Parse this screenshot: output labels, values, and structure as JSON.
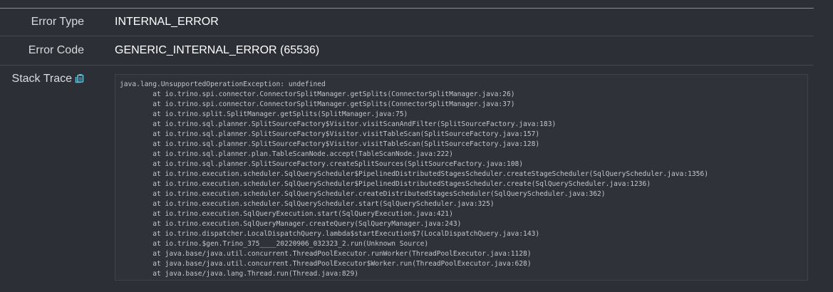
{
  "details": {
    "error_type": {
      "label": "Error Type",
      "value": "INTERNAL_ERROR"
    },
    "error_code": {
      "label": "Error Code",
      "value": "GENERIC_INTERNAL_ERROR (65536)"
    },
    "stack_trace": {
      "label": "Stack Trace",
      "copy_icon": "clipboard-icon",
      "accent_color": "#5bc0de",
      "text": "java.lang.UnsupportedOperationException: undefined\n\tat io.trino.spi.connector.ConnectorSplitManager.getSplits(ConnectorSplitManager.java:26)\n\tat io.trino.spi.connector.ConnectorSplitManager.getSplits(ConnectorSplitManager.java:37)\n\tat io.trino.split.SplitManager.getSplits(SplitManager.java:75)\n\tat io.trino.sql.planner.SplitSourceFactory$Visitor.visitScanAndFilter(SplitSourceFactory.java:183)\n\tat io.trino.sql.planner.SplitSourceFactory$Visitor.visitTableScan(SplitSourceFactory.java:157)\n\tat io.trino.sql.planner.SplitSourceFactory$Visitor.visitTableScan(SplitSourceFactory.java:128)\n\tat io.trino.sql.planner.plan.TableScanNode.accept(TableScanNode.java:222)\n\tat io.trino.sql.planner.SplitSourceFactory.createSplitSources(SplitSourceFactory.java:108)\n\tat io.trino.execution.scheduler.SqlQueryScheduler$PipelinedDistributedStagesScheduler.createStageScheduler(SqlQueryScheduler.java:1356)\n\tat io.trino.execution.scheduler.SqlQueryScheduler$PipelinedDistributedStagesScheduler.create(SqlQueryScheduler.java:1236)\n\tat io.trino.execution.scheduler.SqlQueryScheduler.createDistributedStagesScheduler(SqlQueryScheduler.java:362)\n\tat io.trino.execution.scheduler.SqlQueryScheduler.start(SqlQueryScheduler.java:325)\n\tat io.trino.execution.SqlQueryExecution.start(SqlQueryExecution.java:421)\n\tat io.trino.execution.SqlQueryManager.createQuery(SqlQueryManager.java:243)\n\tat io.trino.dispatcher.LocalDispatchQuery.lambda$startExecution$7(LocalDispatchQuery.java:143)\n\tat io.trino.$gen.Trino_375____20220906_032323_2.run(Unknown Source)\n\tat java.base/java.util.concurrent.ThreadPoolExecutor.runWorker(ThreadPoolExecutor.java:1128)\n\tat java.base/java.util.concurrent.ThreadPoolExecutor$Worker.run(ThreadPoolExecutor.java:628)\n\tat java.base/java.lang.Thread.run(Thread.java:829)"
    }
  }
}
